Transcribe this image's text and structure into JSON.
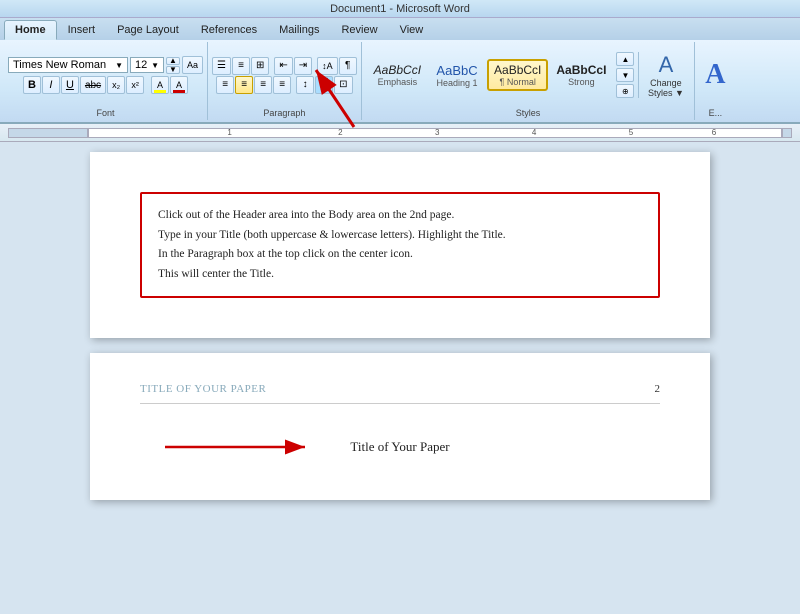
{
  "title_bar": {
    "text": "Document1 - Microsoft Word"
  },
  "tabs": [
    {
      "label": "Home",
      "active": true
    },
    {
      "label": "Insert",
      "active": false
    },
    {
      "label": "Page Layout",
      "active": false
    },
    {
      "label": "References",
      "active": false
    },
    {
      "label": "Mailings",
      "active": false
    },
    {
      "label": "Review",
      "active": false
    },
    {
      "label": "View",
      "active": false
    }
  ],
  "font_group": {
    "label": "Font",
    "font_name": "Times New Roman",
    "font_size": "12",
    "bold": "B",
    "italic": "I",
    "underline": "U",
    "strikethrough": "abc",
    "subscript": "x₂",
    "superscript": "x²",
    "clear": "Aa",
    "color": "A",
    "highlight": "A"
  },
  "paragraph_group": {
    "label": "Paragraph"
  },
  "styles_group": {
    "label": "Styles",
    "items": [
      {
        "label": "Emphasis",
        "sample": "AaBbCcI",
        "active": false
      },
      {
        "label": "Heading 1",
        "sample": "AaBbC",
        "active": false
      },
      {
        "label": "¶ Normal",
        "sample": "AaBbCcI",
        "active": true
      },
      {
        "label": "Strong",
        "sample": "AaBbCcI",
        "active": false
      }
    ],
    "change_styles_label": "Change\nStyles"
  },
  "page1": {
    "instructions": [
      "Click out of the Header area into the Body area on the 2nd page.",
      "Type in your Title (both uppercase & lowercase letters). Highlight the Title.",
      "In the Paragraph box at the top click on the center icon.",
      "This will center the Title."
    ]
  },
  "page2": {
    "header_text": "TITLE OF YOUR PAPER",
    "page_number": "2",
    "title": "Title of Your Paper",
    "arrow_label": "Title of Your Paper"
  }
}
